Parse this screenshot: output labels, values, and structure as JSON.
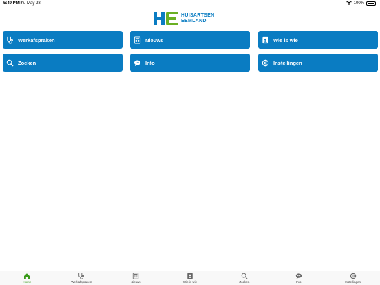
{
  "status": {
    "time": "5:49 PM",
    "date": "Thu May 28",
    "battery": "100%"
  },
  "logo": {
    "line1": "HUISARTSEN",
    "line2": "EEMLAND"
  },
  "tiles": [
    {
      "label": "Werkafspraken",
      "icon": "stethoscope-icon"
    },
    {
      "label": "Nieuws",
      "icon": "newspaper-icon"
    },
    {
      "label": "Wie is wie",
      "icon": "contact-card-icon"
    },
    {
      "label": "Zoeken",
      "icon": "search-icon"
    },
    {
      "label": "Info",
      "icon": "speech-bubble-icon"
    },
    {
      "label": "Instellingen",
      "icon": "gear-icon"
    }
  ],
  "tabs": [
    {
      "label": "Home",
      "icon": "home-icon",
      "active": true
    },
    {
      "label": "Werkafspraken",
      "icon": "stethoscope-icon"
    },
    {
      "label": "Nieuws",
      "icon": "newspaper-icon"
    },
    {
      "label": "Wie is wie",
      "icon": "contact-card-icon"
    },
    {
      "label": "Zoeken",
      "icon": "search-icon"
    },
    {
      "label": "Info",
      "icon": "speech-bubble-icon"
    },
    {
      "label": "Instellingen",
      "icon": "gear-icon"
    }
  ],
  "colors": {
    "brand_blue": "#0a7cc2",
    "brand_green": "#6ab023",
    "active_tab": "#3a9a1a"
  }
}
